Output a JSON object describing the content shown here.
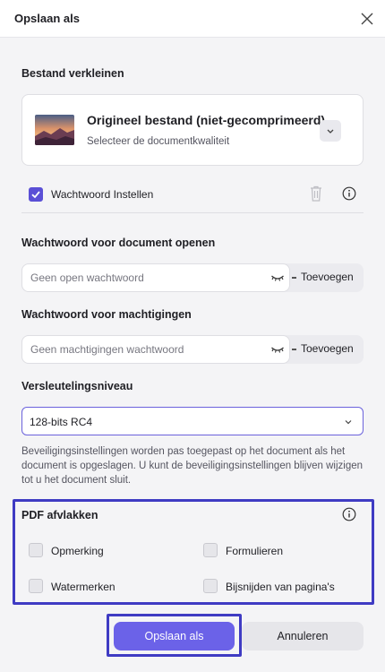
{
  "dialog": {
    "title": "Opslaan als"
  },
  "compress": {
    "section_label": "Bestand verkleinen",
    "card_title": "Origineel bestand (niet-gecomprimeerd)",
    "card_subtitle": "Selecteer de documentkwaliteit"
  },
  "password": {
    "checkbox_label": "Wachtwoord Instellen",
    "checkbox_checked": true,
    "open_label": "Wachtwoord voor document openen",
    "open_placeholder": "Geen open wachtwoord",
    "open_add": "Toevoegen",
    "perm_label": "Wachtwoord voor machtigingen",
    "perm_placeholder": "Geen machtigingen wachtwoord",
    "perm_add": "Toevoegen"
  },
  "encryption": {
    "label": "Versleutelingsniveau",
    "value": "128-bits RC4",
    "note": "Beveiligingsinstellingen worden pas toegepast op het document als het document is opgeslagen. U kunt de beveiligingsinstellingen blijven wijzigen tot u het document sluit."
  },
  "flatten": {
    "label": "PDF afvlakken",
    "options": [
      {
        "label": "Opmerking",
        "checked": false
      },
      {
        "label": "Formulieren",
        "checked": false
      },
      {
        "label": "Watermerken",
        "checked": false
      },
      {
        "label": "Bijsnijden van pagina's",
        "checked": false
      }
    ]
  },
  "footer": {
    "save_label": "Opslaan als",
    "cancel_label": "Annuleren"
  },
  "colors": {
    "accent": "#6b62e8",
    "highlight": "#3f3bc3",
    "checkbox": "#5a4fd6"
  }
}
